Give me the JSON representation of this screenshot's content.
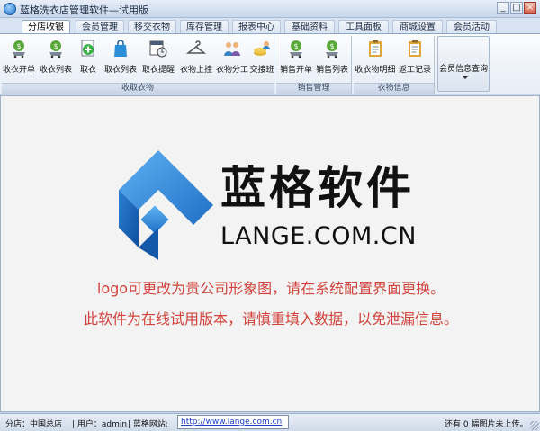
{
  "window": {
    "title": "蓝格洗衣店管理软件—试用版",
    "minimize": "_",
    "maximize": "□",
    "close": "×"
  },
  "tabs": [
    {
      "label": "分店收银",
      "active": true
    },
    {
      "label": "会员管理"
    },
    {
      "label": "移交衣物"
    },
    {
      "label": "库存管理"
    },
    {
      "label": "报表中心"
    },
    {
      "label": "基础资料"
    },
    {
      "label": "工具面板"
    },
    {
      "label": "商城设置"
    },
    {
      "label": "会员活动"
    }
  ],
  "ribbon": {
    "groups": [
      {
        "label": "收取衣物",
        "buttons": [
          {
            "label": "收衣开单",
            "icon": "money-bag-cart-icon"
          },
          {
            "label": "收衣列表",
            "icon": "money-bag-cart-icon"
          },
          {
            "label": "取衣",
            "icon": "document-plus-icon"
          },
          {
            "label": "取衣列表",
            "icon": "shopping-bag-icon"
          },
          {
            "label": "取衣提醒",
            "icon": "calendar-alarm-icon"
          },
          {
            "label": "衣物上挂",
            "icon": "hanger-icon"
          },
          {
            "label": "衣物分工",
            "icon": "people-icon"
          },
          {
            "label": "交接班",
            "icon": "coins-user-icon"
          }
        ]
      },
      {
        "label": "销售管理",
        "buttons": [
          {
            "label": "销售开单",
            "icon": "money-bag-cart-icon"
          },
          {
            "label": "销售列表",
            "icon": "money-bag-cart-icon"
          }
        ]
      },
      {
        "label": "衣物信息",
        "buttons": [
          {
            "label": "收衣物明细",
            "icon": "clipboard-icon"
          },
          {
            "label": "返工记录",
            "icon": "clipboard-icon"
          }
        ]
      }
    ],
    "member_query": {
      "label": "会员信息查询",
      "icon": "dropdown-arrow-icon"
    }
  },
  "main": {
    "brand_cn": "蓝格软件",
    "brand_en": "LANGE.COM.CN",
    "notice_line1": "logo可更改为贵公司形象图，请在系统配置界面更换。",
    "notice_line2": "此软件为在线试用版本，请慎重填入数据，以免泄漏信息。",
    "logo_color": "#2a7fd4"
  },
  "status": {
    "branch": "分店：中国总店",
    "user": "| 用户：admin",
    "site_label": "| 蓝格网站:",
    "site_url": "http://www.lange.com.cn",
    "images": "还有 0 幅图片未上传。"
  }
}
